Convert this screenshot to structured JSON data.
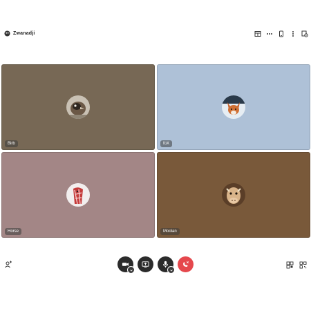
{
  "room": {
    "name": "Zwanadji"
  },
  "header_icons": [
    "layout-icon",
    "more-icon",
    "device-icon",
    "overflow-icon",
    "settings-icon"
  ],
  "participants": [
    {
      "name": "Birb",
      "color": "#7a6b57",
      "avatar": "bird-photo"
    },
    {
      "name": "foX",
      "color": "#b2c6dd",
      "avatar": "fox-photo"
    },
    {
      "name": "Horse",
      "color": "#a78a89",
      "avatar": "horse-photo"
    },
    {
      "name": "Moolan",
      "color": "#7c5b3b",
      "avatar": "cow-photo"
    }
  ],
  "controls": {
    "camera": "camera-icon",
    "screenshare": "screenshare-icon",
    "mic": "microphone-icon",
    "hangup": "hangup-icon",
    "hangup_color": "#e5484d"
  }
}
